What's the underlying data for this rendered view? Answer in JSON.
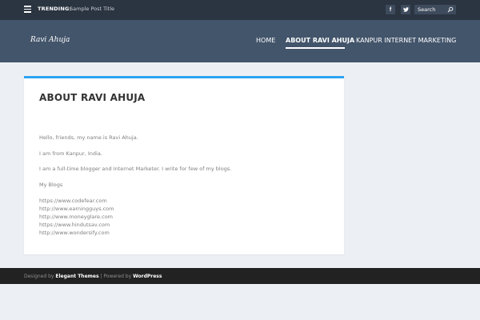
{
  "topbar": {
    "trending_label": "TRENDING:",
    "trending_post": "Sample Post Title",
    "social": [
      {
        "icon": "facebook-icon",
        "glyph": "f"
      },
      {
        "icon": "twitter-icon",
        "glyph": "t"
      }
    ],
    "search_placeholder": "Search"
  },
  "header": {
    "logo": "Ravi Ahuja",
    "nav": [
      "HOME",
      "ABOUT RAVI AHUJA",
      "KANPUR INTERNET MARKETING"
    ]
  },
  "post": {
    "title": "ABOUT RAVI AHUJA",
    "paragraphs": [
      "Hello, friends, my name is Ravi Ahuja.",
      "I am from Kanpur, India.",
      "I am a full-time blogger and Internet Marketer. I write for few of my blogs.",
      "My Blogs"
    ],
    "blogs": [
      "https://www.codefear.com",
      "http://www.earningguys.com",
      "http://www.moneyglare.com",
      "https://www.hindutsav.com",
      "http://www.wondersify.com"
    ]
  },
  "footer": {
    "designed_by": "Designed by",
    "elegant_themes": "Elegant Themes",
    "separator": "| Powered by",
    "wordpress": "WordPress"
  },
  "colors": {
    "topbar": "#2b3441",
    "header": "#43556b",
    "accent": "#2ea3f2",
    "background": "#ecf0f5",
    "footer": "#222222"
  }
}
